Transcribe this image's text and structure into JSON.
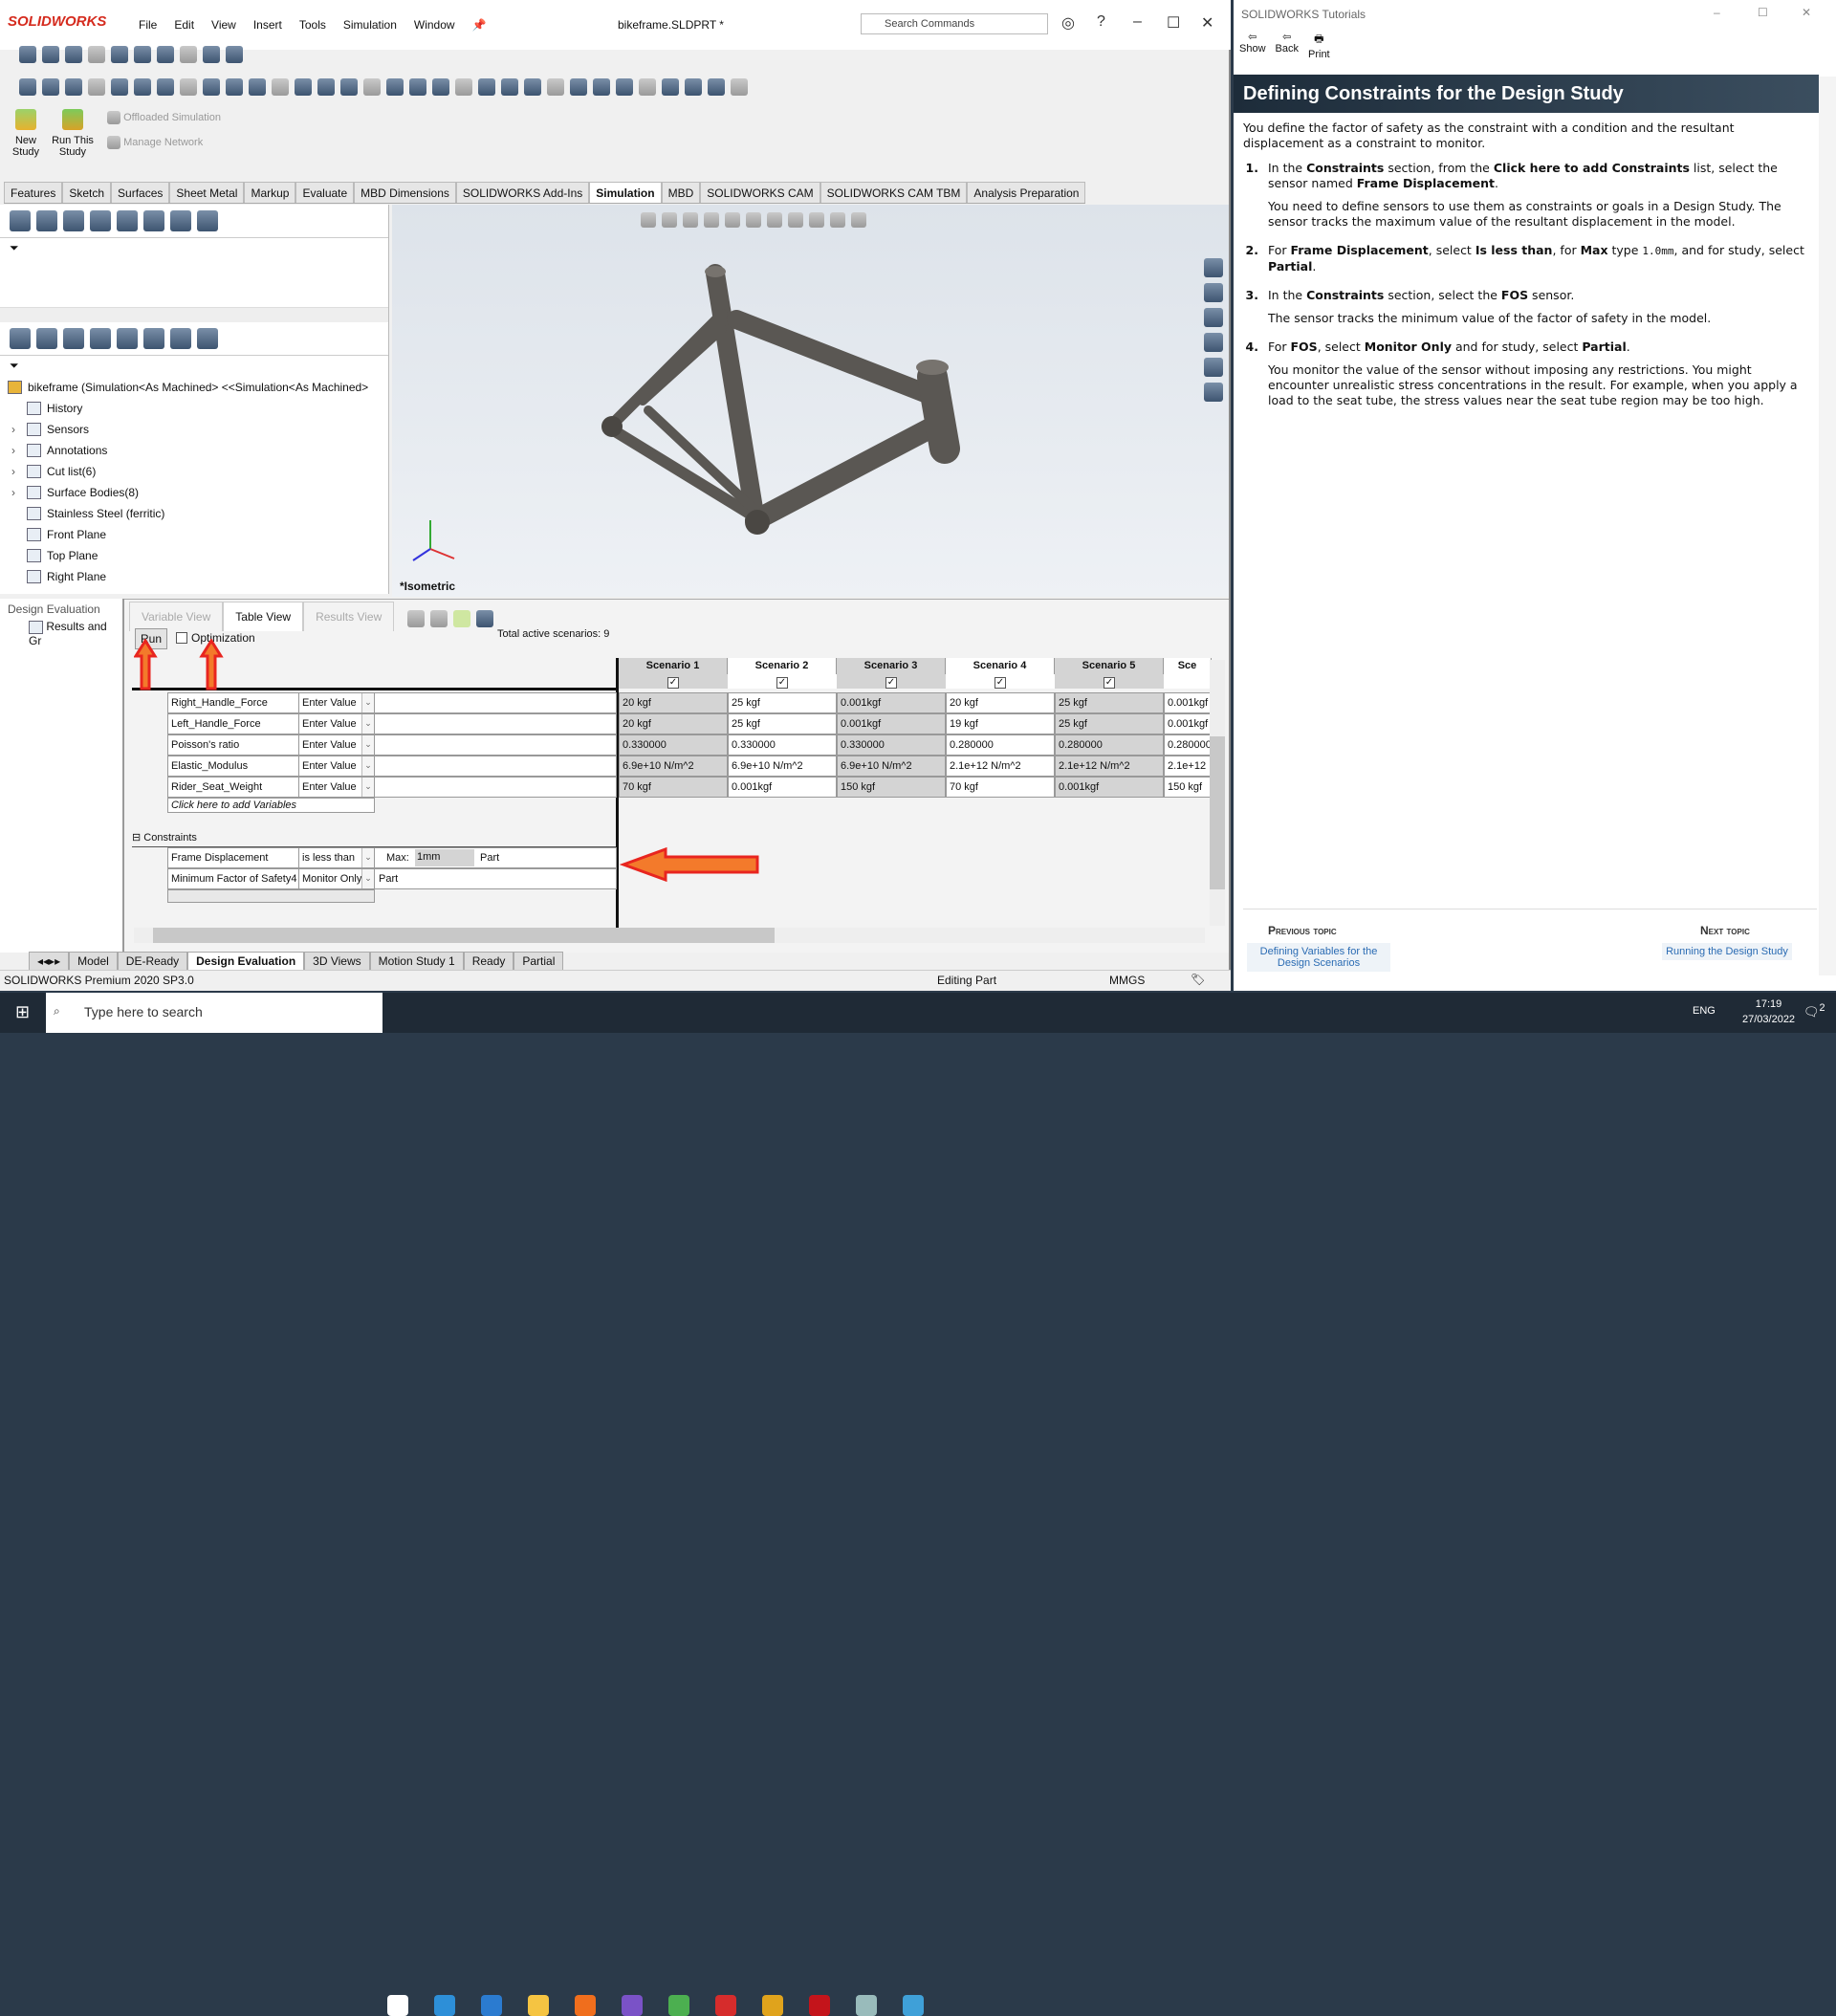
{
  "app": {
    "brand": "SOLIDWORKS",
    "doc_title": "bikeframe.SLDPRT *",
    "search_placeholder": "Search Commands",
    "menu": [
      "File",
      "Edit",
      "View",
      "Insert",
      "Tools",
      "Simulation",
      "Window"
    ]
  },
  "ribbon": {
    "new_study": "New Study",
    "run_study": "Run This Study",
    "offloaded": "Offloaded Simulation",
    "manage_network": "Manage Network"
  },
  "command_tabs": [
    "Features",
    "Sketch",
    "Surfaces",
    "Sheet Metal",
    "Markup",
    "Evaluate",
    "MBD Dimensions",
    "SOLIDWORKS Add-Ins",
    "Simulation",
    "MBD",
    "SOLIDWORKS CAM",
    "SOLIDWORKS CAM TBM",
    "Analysis Preparation"
  ],
  "active_command_tab": "Simulation",
  "feature_tree": {
    "root": "bikeframe  (Simulation<As Machined> <<Simulation<As Machined>",
    "items": [
      {
        "label": "History",
        "expand": false
      },
      {
        "label": "Sensors",
        "expand": true
      },
      {
        "label": "Annotations",
        "expand": true
      },
      {
        "label": "Cut list(6)",
        "expand": true
      },
      {
        "label": "Surface Bodies(8)",
        "expand": true
      },
      {
        "label": "Stainless Steel (ferritic)",
        "expand": false
      },
      {
        "label": "Front Plane",
        "expand": false
      },
      {
        "label": "Top Plane",
        "expand": false
      },
      {
        "label": "Right Plane",
        "expand": false
      }
    ]
  },
  "viewport": {
    "view_label": "*Isometric",
    "part_color": "#5a5753"
  },
  "design_eval": {
    "tree_root": "Design Evaluation",
    "tree_child": "Results and Gr",
    "views": [
      "Variable View",
      "Table View",
      "Results View"
    ],
    "active_view": "Table View",
    "run": "Run",
    "optimization": "Optimization",
    "optimization_checked": false,
    "total_active": "Total active scenarios:  9",
    "scenarios": [
      {
        "name": "Scenario 1",
        "checked": true
      },
      {
        "name": "Scenario 2",
        "checked": true
      },
      {
        "name": "Scenario 3",
        "checked": true
      },
      {
        "name": "Scenario 4",
        "checked": true
      },
      {
        "name": "Scenario 5",
        "checked": true
      },
      {
        "name": "Sce",
        "checked": true
      }
    ],
    "variables": [
      {
        "name": "Right_Handle_Force",
        "mode": "Enter Value",
        "values": [
          "20 kgf",
          "25 kgf",
          "0.001kgf",
          "20 kgf",
          "25 kgf",
          "0.001kgf"
        ]
      },
      {
        "name": "Left_Handle_Force",
        "mode": "Enter Value",
        "values": [
          "20 kgf",
          "25 kgf",
          "0.001kgf",
          "19 kgf",
          "25 kgf",
          "0.001kgf"
        ]
      },
      {
        "name": "Poisson's ratio",
        "mode": "Enter Value",
        "values": [
          "0.330000",
          "0.330000",
          "0.330000",
          "0.280000",
          "0.280000",
          "0.280000"
        ]
      },
      {
        "name": "Elastic_Modulus",
        "mode": "Enter Value",
        "values": [
          "6.9e+10 N/m^2",
          "6.9e+10 N/m^2",
          "6.9e+10 N/m^2",
          "2.1e+12 N/m^2",
          "2.1e+12 N/m^2",
          "2.1e+12"
        ]
      },
      {
        "name": "Rider_Seat_Weight",
        "mode": "Enter Value",
        "values": [
          "70 kgf",
          "0.001kgf",
          "150 kgf",
          "70 kgf",
          "0.001kgf",
          "150 kgf"
        ]
      }
    ],
    "add_variables": "Click here to add Variables",
    "constraints_label": "Constraints",
    "constraints": [
      {
        "name": "Frame Displacement",
        "condition": "is less than",
        "max_label": "Max:",
        "max": "1mm",
        "study": "Part"
      },
      {
        "name": "Minimum Factor of Safety4",
        "condition": "Monitor Only",
        "study": "Part"
      }
    ],
    "annotation_color": "#e8251f"
  },
  "bottom_tabs": [
    "Model",
    "DE-Ready",
    "Design Evaluation",
    "3D Views",
    "Motion Study 1",
    "Ready",
    "Partial"
  ],
  "active_bottom_tab": "Design Evaluation",
  "status": {
    "product": "SOLIDWORKS Premium 2020 SP3.0",
    "mode": "Editing Part",
    "units": "MMGS"
  },
  "tutorial": {
    "window_title": "SOLIDWORKS Tutorials",
    "toolbar": [
      "Show",
      "Back",
      "Print"
    ],
    "heading": "Defining Constraints for the Design Study",
    "intro": "You define the factor of safety as the constraint with a condition and the resultant displacement as a constraint to monitor.",
    "steps": [
      {
        "num": "1.",
        "text": [
          [
            "In the ",
            0
          ],
          [
            "Constraints",
            1
          ],
          [
            " section, from the ",
            0
          ],
          [
            "Click here to add Constraints",
            1
          ],
          [
            " list, select the sensor named ",
            0
          ],
          [
            "Frame Displacement",
            1
          ],
          [
            ".",
            0
          ]
        ],
        "note": "You need to define sensors to use them as constraints or goals in a Design Study. The sensor tracks the maximum value of the resultant displacement in the model."
      },
      {
        "num": "2.",
        "text": [
          [
            "For ",
            0
          ],
          [
            "Frame Displacement",
            1
          ],
          [
            ", select ",
            0
          ],
          [
            "Is less than",
            1
          ],
          [
            ", for ",
            0
          ],
          [
            "Max",
            1
          ],
          [
            " type ",
            0
          ],
          [
            "1.0mm",
            2
          ],
          [
            ", and for study, select ",
            0
          ],
          [
            "Partial",
            1
          ],
          [
            ".",
            0
          ]
        ],
        "note": ""
      },
      {
        "num": "3.",
        "text": [
          [
            "In the ",
            0
          ],
          [
            "Constraints",
            1
          ],
          [
            " section, select the ",
            0
          ],
          [
            "FOS",
            1
          ],
          [
            " sensor.",
            0
          ]
        ],
        "note": "The sensor tracks the minimum value of the factor of safety in the model."
      },
      {
        "num": "4.",
        "text": [
          [
            "For ",
            0
          ],
          [
            "FOS",
            1
          ],
          [
            ", select ",
            0
          ],
          [
            "Monitor Only",
            1
          ],
          [
            " and for study, select ",
            0
          ],
          [
            "Partial",
            1
          ],
          [
            ".",
            0
          ]
        ],
        "note": "You monitor the value of the sensor without imposing any restrictions. You might encounter unrealistic stress concentrations in the result. For example, when you apply a load to the seat tube, the stress values near the seat tube region may be too high."
      }
    ],
    "prev_label": "Previous topic",
    "prev_link": "Defining Variables for the Design Scenarios",
    "next_label": "Next topic",
    "next_link": "Running the Design Study"
  },
  "taskbar": {
    "search_placeholder": "Type here to search",
    "lang": "ENG",
    "time": "17:19",
    "date": "27/03/2022",
    "notifications": "2"
  }
}
